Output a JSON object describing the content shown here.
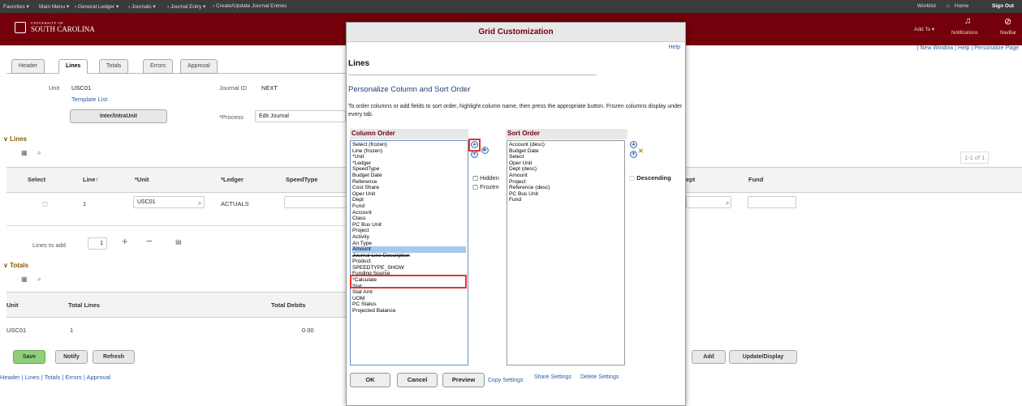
{
  "topbar": {
    "favorites": "Favorites ▾",
    "main_menu": "Main Menu ▾",
    "crumb1": "› General Ledger ▾",
    "crumb2": "› Journals ▾",
    "crumb3": "› Journal Entry ▾",
    "crumb4": "› Create/Update Journal Entries",
    "worklist": "Worklist",
    "home": "Home",
    "signout": "Sign Out"
  },
  "brand": {
    "line1": "UNIVERSITY OF",
    "line2": "SOUTH CAROLINA",
    "add_to": "Add To ▾",
    "notifications": "Notifications",
    "navbar": "NavBar"
  },
  "right_links": "| New Window | Help | Personalize Page",
  "tabs": [
    "Header",
    "Lines",
    "Totals",
    "Errors",
    "Approval"
  ],
  "header": {
    "unit_label": "Unit",
    "unit_value": "USC01",
    "template_list": "Template List",
    "interunit": "Inter/IntraUnit",
    "journal_id_label": "Journal ID",
    "journal_id_value": "NEXT",
    "process_label": "*Process",
    "process_value": "Edit Journal"
  },
  "lines": {
    "title": "Lines",
    "pager": "1-1 of 1",
    "cols": [
      "Select",
      "Line↑",
      "*Unit",
      "*Ledger",
      "SpeedType",
      "ept",
      "Fund"
    ],
    "row": {
      "line": "1",
      "unit": "USC01",
      "ledger": "ACTUALS"
    },
    "lines_to_add_label": "Lines to add",
    "lines_to_add_value": "1"
  },
  "totals": {
    "title": "Totals",
    "cols": [
      "Unit",
      "Total Lines",
      "Total Debits"
    ],
    "row": {
      "unit": "USC01",
      "lines": "1",
      "debits": "0.00"
    }
  },
  "buttons": {
    "save": "Save",
    "notify": "Notify",
    "refresh": "Refresh",
    "add": "Add",
    "update_display": "Update/Display"
  },
  "footer_links": [
    "Header",
    "Lines",
    "Totals",
    "Errors",
    "Approval"
  ],
  "modal": {
    "title": "Grid Customization",
    "help": "Help",
    "subtitle": "Lines",
    "section": "Personalize Column and Sort Order",
    "instructions": "To order columns or add fields to sort order, highlight column name, then press the appropriate button. Frozen columns display under every tab.",
    "column_order_label": "Column Order",
    "sort_order_label": "Sort Order",
    "column_order": [
      "Select (frozen)",
      "Line (frozen)",
      "*Unit",
      "*Ledger",
      "SpeedType",
      "Budget Date",
      "Reference",
      "Cost Share",
      "Oper Unit",
      "Dept",
      "Fund",
      "Account",
      "Class",
      "PC Bus Unit",
      "Project",
      "Activity",
      "An Type",
      "Amount",
      "Journal Line Description",
      "Product",
      "SPEEDTYPE_SHOW",
      "Funding Source",
      "*Calculate",
      "Stat",
      "Stat Amt",
      "UOM",
      "PC Status",
      "Projected Balance"
    ],
    "selected_index": 17,
    "sort_order": [
      "Account (desc)",
      "Budget Date",
      "Select",
      "Oper Unit",
      "Dept (desc)",
      "Amount",
      "Project",
      "Reference (desc)",
      "PC Bus Unit",
      "Fund"
    ],
    "hidden_label": "Hidden",
    "frozen_label": "Frozen",
    "descending_label": "Descending",
    "ok": "OK",
    "cancel": "Cancel",
    "preview": "Preview",
    "copy_settings": "Copy Settings",
    "share_settings": "Share Settings",
    "delete_settings": "Delete Settings"
  },
  "colors": {
    "brand": "#73000a",
    "highlight": "#e3342f"
  }
}
